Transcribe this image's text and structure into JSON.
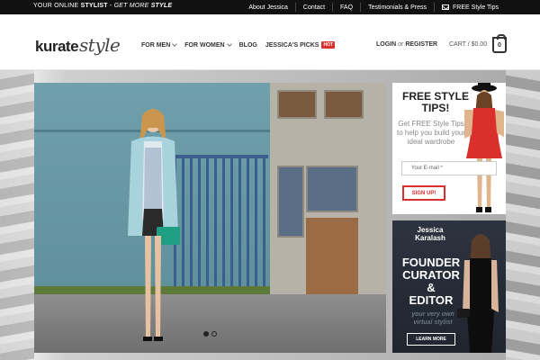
{
  "topbar": {
    "tagline_prefix": "YOUR ONLINE ",
    "tagline_bold": "STYLIST",
    "tagline_mid": " - ",
    "tagline_italic": "GET MORE ",
    "tagline_italic_bold": "STYLE",
    "links": [
      "About Jessica",
      "Contact",
      "FAQ",
      "Testimonials & Press"
    ],
    "tips_link": "FREE Style Tips"
  },
  "header": {
    "logo_main": "kurate",
    "logo_script": "style",
    "nav": [
      {
        "label": "FOR MEN",
        "dropdown": true
      },
      {
        "label": "FOR WOMEN",
        "dropdown": true
      },
      {
        "label": "BLOG",
        "dropdown": false
      },
      {
        "label": "JESSICA'S PICKS",
        "dropdown": false,
        "badge": "HOT"
      }
    ],
    "login": "LOGIN",
    "login_or": "or",
    "register": "REGISTER",
    "cart_label": "CART / $0.00",
    "cart_count": "0"
  },
  "slider": {
    "slides": 2,
    "active": 1
  },
  "tips_card": {
    "title_line1": "FREE STYLE",
    "title_line2": "TIPS!",
    "text": "Get FREE Style Tips to help you build your ideal wardrobe",
    "email_placeholder": "Your E-mail *",
    "button": "SIGN UP!"
  },
  "founder_card": {
    "name_line1": "Jessica",
    "name_line2": "Karalash",
    "role1": "FOUNDER",
    "role2": "CURATOR",
    "role3": "&",
    "role4": "EDITOR",
    "sub_line1": "your very own",
    "sub_line2": "virtual stylist",
    "button": "LEARN MORE"
  },
  "colors": {
    "topbar_bg": "#111111",
    "accent_red": "#d9302c",
    "founder_bg": "#2d3440"
  }
}
